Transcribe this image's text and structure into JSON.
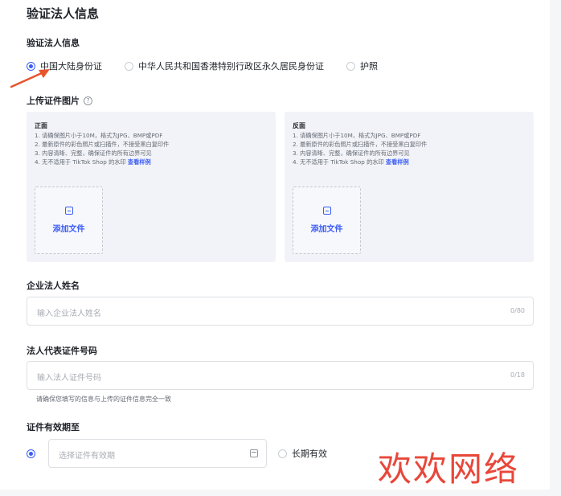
{
  "header": {
    "title": "验证法人信息"
  },
  "id_type": {
    "label": "验证法人信息",
    "options": [
      {
        "label": "中国大陆身份证",
        "checked": true
      },
      {
        "label": "中华人民共和国香港特别行政区永久居民身份证",
        "checked": false
      },
      {
        "label": "护照",
        "checked": false
      }
    ]
  },
  "upload": {
    "title": "上传证件图片",
    "help_glyph": "?",
    "front": {
      "heading": "正面",
      "line1": "1. 请确保图片小于10M，格式为JPG、BMP或PDF",
      "line2": "2. 最新原件的彩色照片或扫描件，不接受黑白复印件",
      "line3": "3. 内容清晰、完整，确保证件的所有边界可见",
      "line4": "4. 无不适用于 TikTok Shop 的水印 ",
      "link": "查看样例",
      "add_label": "添加文件"
    },
    "back": {
      "heading": "反面",
      "line1": "1. 请确保图片小于10M，格式为JPG、BMP或PDF",
      "line2": "2. 最新原件的彩色照片或扫描件，不接受黑白复印件",
      "line3": "3. 内容清晰、完整，确保证件的所有边界可见",
      "line4": "4. 无不适用于 TikTok Shop 的水印 ",
      "link": "查看样例",
      "add_label": "添加文件"
    }
  },
  "legal_name": {
    "label": "企业法人姓名",
    "placeholder": "输入企业法人姓名",
    "count": "0/80"
  },
  "id_number": {
    "label": "法人代表证件号码",
    "placeholder": "输入法人证件号码",
    "count": "0/18",
    "hint": "请确保您填写的信息与上传的证件信息完全一致"
  },
  "validity": {
    "label": "证件有效期至",
    "placeholder": "选择证件有效期",
    "long_term": "长期有效"
  },
  "watermark": "欢欢网络",
  "colors": {
    "accent": "#3c5df6",
    "arrow": "#e8542b",
    "watermark": "#e8473a"
  }
}
